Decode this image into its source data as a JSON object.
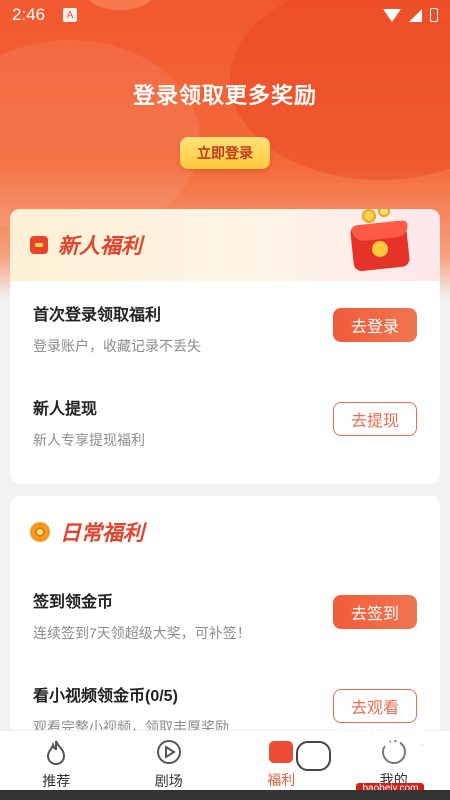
{
  "status_bar": {
    "time": "2:46",
    "notif_icon_letter": "A"
  },
  "hero": {
    "title": "登录领取更多奖励",
    "login_button": "立即登录"
  },
  "new_user_section": {
    "title": "新人福利",
    "icon": "red-envelope-icon",
    "items": [
      {
        "title": "首次登录领取福利",
        "subtitle": "登录账户，收藏记录不丢失",
        "button": "去登录",
        "style": "filled"
      },
      {
        "title": "新人提现",
        "subtitle": "新人专享提现福利",
        "button": "去提现",
        "style": "outline"
      }
    ]
  },
  "daily_section": {
    "title": "日常福利",
    "icon": "coin-icon",
    "items": [
      {
        "title": "签到领金币",
        "subtitle": "连续签到7天领超级大奖，可补签！",
        "button": "去签到",
        "style": "filled"
      },
      {
        "title": "看小视频领金币(0/5)",
        "subtitle": "观看完整小视频，领取丰厚奖励",
        "button": "去观看",
        "style": "outline"
      }
    ]
  },
  "tabbar": {
    "tabs": [
      {
        "label": "推荐",
        "icon": "flame-icon",
        "active": false
      },
      {
        "label": "剧场",
        "icon": "play-icon",
        "active": false
      },
      {
        "label": "福利",
        "icon": "gift-icon",
        "active": true
      },
      {
        "label": "我的",
        "icon": "user-icon",
        "active": false
      }
    ]
  },
  "watermark": {
    "text": "宝贝游戏网",
    "url": "baobeiy.com"
  },
  "colors": {
    "accent": "#ef5b3a",
    "hero": "#f2582f",
    "gold": "#ffca3a"
  }
}
